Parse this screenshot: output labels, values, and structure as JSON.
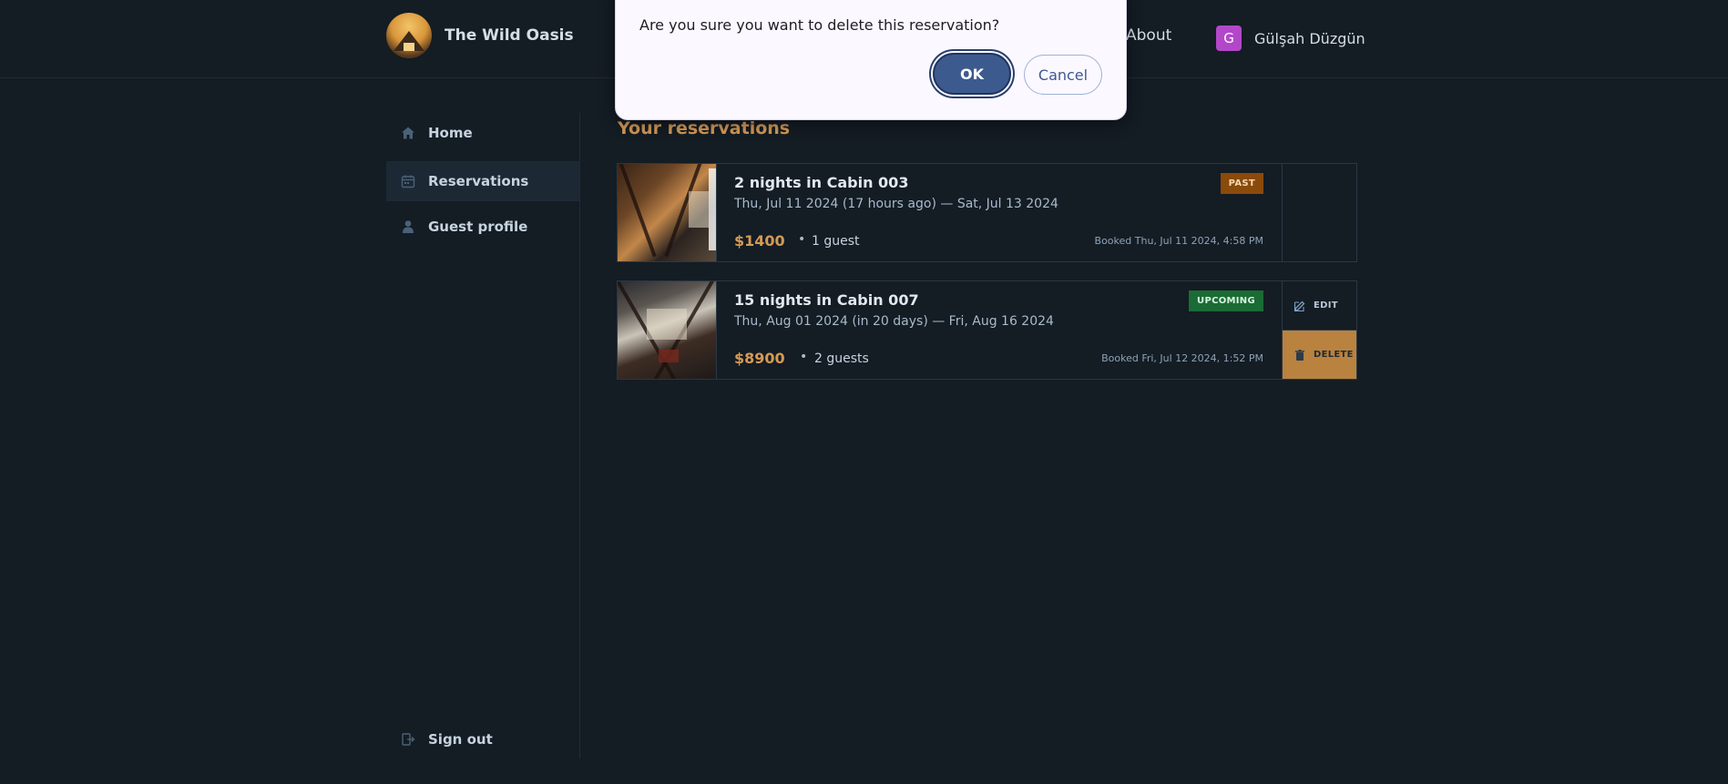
{
  "header": {
    "app_name": "The Wild Oasis",
    "nav_about": "About",
    "user": {
      "initial": "G",
      "name": "Gülşah Düzgün"
    }
  },
  "sidebar": {
    "items": [
      {
        "label": "Home",
        "icon": "home-icon"
      },
      {
        "label": "Reservations",
        "icon": "calendar-icon",
        "active": true
      },
      {
        "label": "Guest profile",
        "icon": "user-icon"
      }
    ],
    "sign_out": "Sign out"
  },
  "main": {
    "title": "Your reservations",
    "reservations": [
      {
        "title": "2 nights in Cabin 003",
        "dates": "Thu, Jul 11 2024 (17 hours ago) — Sat, Jul 13 2024",
        "price": "$1400",
        "separator": "•",
        "guests": "1 guest",
        "booked": "Booked Thu, Jul 11 2024, 4:58 PM",
        "status": "PAST",
        "status_color": "#8a4a0a"
      },
      {
        "title": "15 nights in Cabin 007",
        "dates": "Thu, Aug 01 2024 (in 20 days) — Fri, Aug 16 2024",
        "price": "$8900",
        "separator": "•",
        "guests": "2 guests",
        "booked": "Booked Fri, Jul 12 2024, 1:52 PM",
        "status": "UPCOMING",
        "status_color": "#1b6b35",
        "actions": {
          "edit": "EDIT",
          "delete": "DELETE"
        }
      }
    ]
  },
  "dialog": {
    "message": "Are you sure you want to delete this reservation?",
    "ok_label": "OK",
    "cancel_label": "Cancel"
  },
  "colors": {
    "background": "#141c24",
    "accent": "#d49a55",
    "delete_bg": "#b9823f",
    "ok_button": "#3d5a8f",
    "avatar": "#b347c9"
  }
}
